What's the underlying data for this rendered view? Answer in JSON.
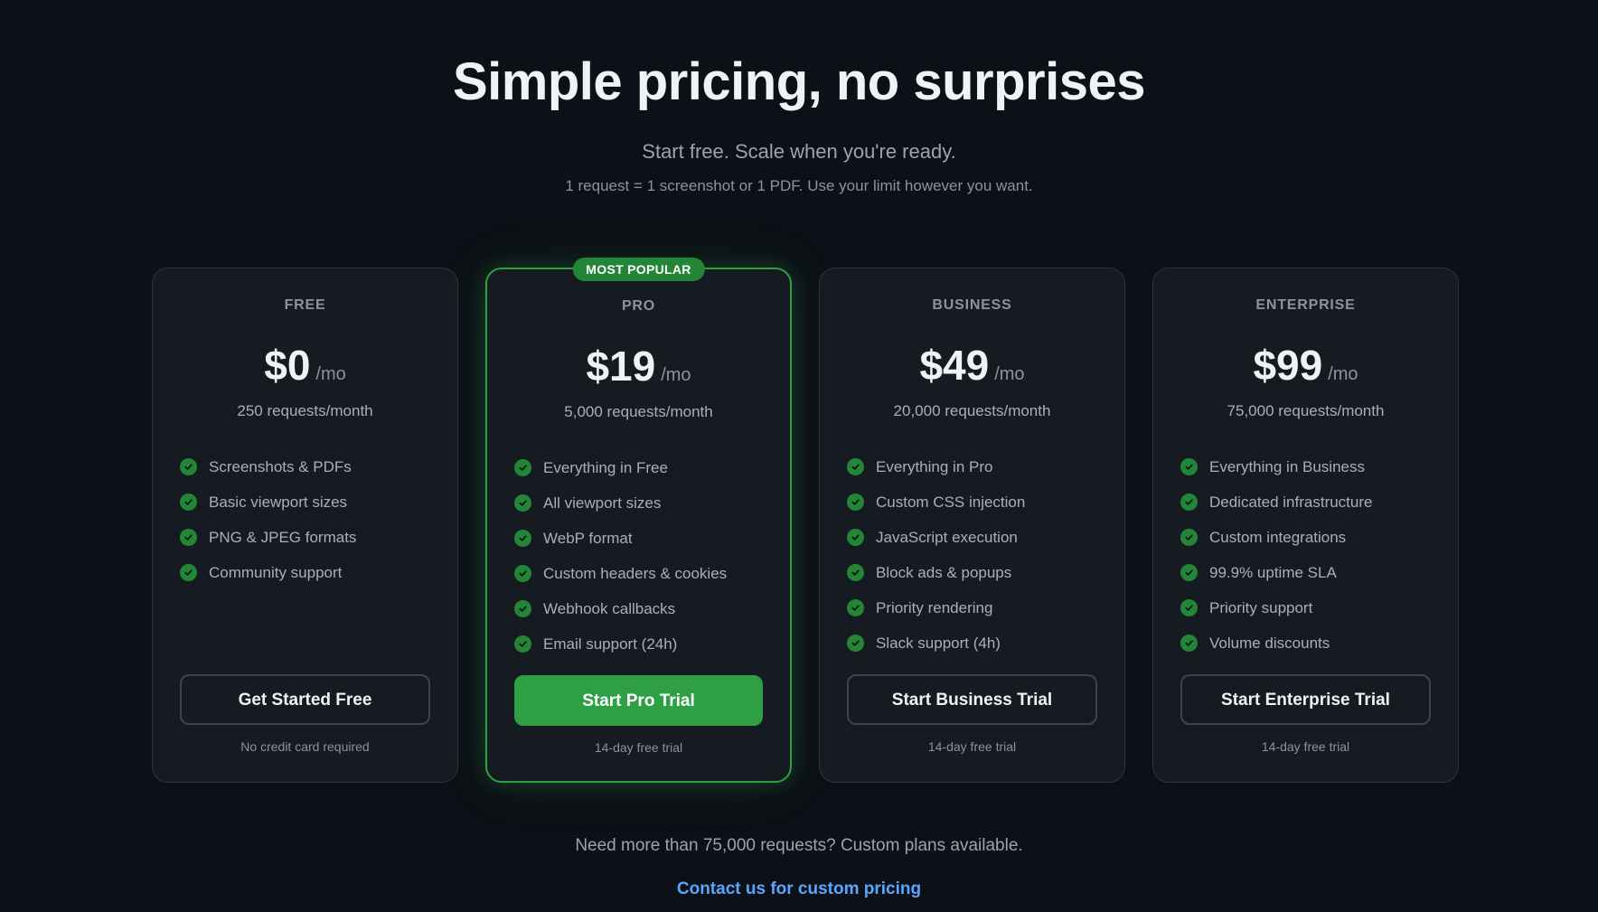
{
  "hero": {
    "title": "Simple pricing, no surprises",
    "subtitle": "Start free. Scale when you're ready.",
    "note": "1 request = 1 screenshot or 1 PDF. Use your limit however you want."
  },
  "badge_label": "MOST POPULAR",
  "plans": [
    {
      "tier": "FREE",
      "price": "$0",
      "period": "/mo",
      "requests": "250 requests/month",
      "features": [
        "Screenshots & PDFs",
        "Basic viewport sizes",
        "PNG & JPEG formats",
        "Community support"
      ],
      "cta": "Get Started Free",
      "fineprint": "No credit card required"
    },
    {
      "tier": "PRO",
      "price": "$19",
      "period": "/mo",
      "requests": "5,000 requests/month",
      "features": [
        "Everything in Free",
        "All viewport sizes",
        "WebP format",
        "Custom headers & cookies",
        "Webhook callbacks",
        "Email support (24h)"
      ],
      "cta": "Start Pro Trial",
      "fineprint": "14-day free trial"
    },
    {
      "tier": "BUSINESS",
      "price": "$49",
      "period": "/mo",
      "requests": "20,000 requests/month",
      "features": [
        "Everything in Pro",
        "Custom CSS injection",
        "JavaScript execution",
        "Block ads & popups",
        "Priority rendering",
        "Slack support (4h)"
      ],
      "cta": "Start Business Trial",
      "fineprint": "14-day free trial"
    },
    {
      "tier": "ENTERPRISE",
      "price": "$99",
      "period": "/mo",
      "requests": "75,000 requests/month",
      "features": [
        "Everything in Business",
        "Dedicated infrastructure",
        "Custom integrations",
        "99.9% uptime SLA",
        "Priority support",
        "Volume discounts"
      ],
      "cta": "Start Enterprise Trial",
      "fineprint": "14-day free trial"
    }
  ],
  "footer": {
    "text": "Need more than 75,000 requests? Custom plans available.",
    "link": "Contact us for custom pricing"
  },
  "colors": {
    "background": "#0d1117",
    "card": "#161b22",
    "accent_green": "#2ea043",
    "link_blue": "#58a6ff"
  },
  "icons": {
    "feature_bullet": "check-circle-icon"
  }
}
